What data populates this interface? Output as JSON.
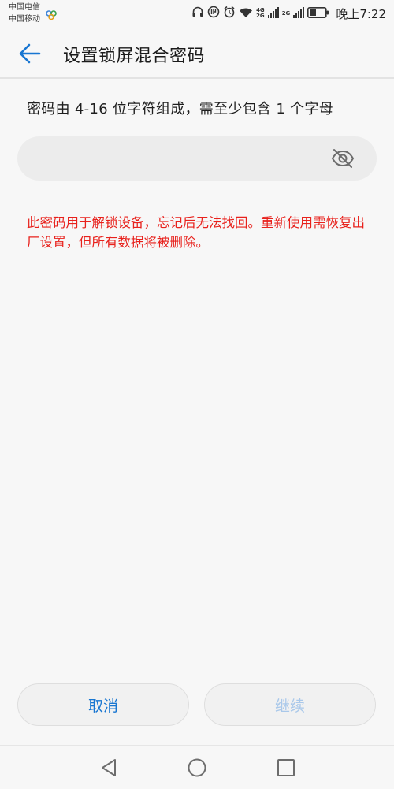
{
  "status_bar": {
    "carrier_1": "中国电信",
    "carrier_2": "中国移动",
    "network_1_top": "4G",
    "network_1_bottom": "2G",
    "network_2": "2G",
    "time": "晚上7:22"
  },
  "header": {
    "title": "设置锁屏混合密码"
  },
  "content": {
    "instruction": "密码由 4-16 位字符组成，需至少包含 1 个字母",
    "password": {
      "value": "",
      "placeholder": ""
    },
    "warning": "此密码用于解锁设备，忘记后无法找回。重新使用需恢复出厂设置，但所有数据将被删除。"
  },
  "buttons": {
    "cancel_label": "取消",
    "continue_label": "继续"
  },
  "colors": {
    "accent": "#1876d1",
    "warning": "#e8211c",
    "disabled_text": "#a9c8ea",
    "background": "#f7f7f7"
  },
  "icons": {
    "back": "arrow-left-icon",
    "toggle_visibility": "eye-off-icon",
    "nav_back": "triangle-back-icon",
    "nav_home": "circle-home-icon",
    "nav_recent": "square-recent-icon"
  }
}
